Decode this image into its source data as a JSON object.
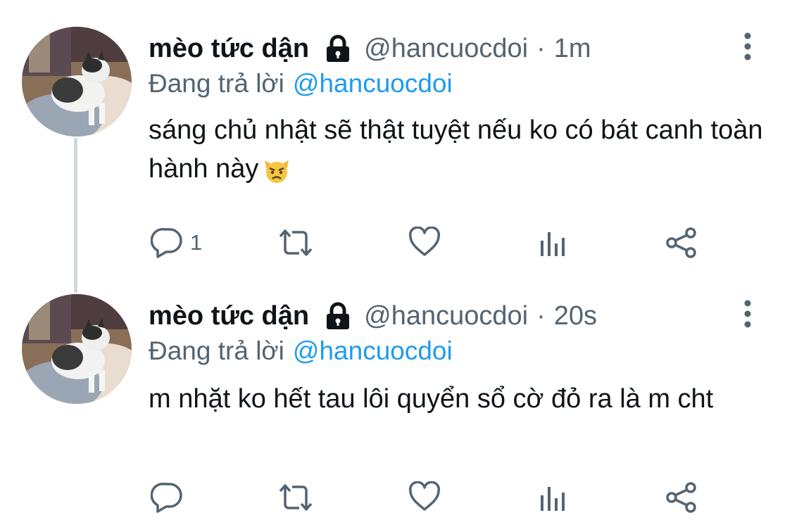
{
  "tweets": [
    {
      "name": "mèo tức dận",
      "handle": "@hancuocdoi",
      "separator": "·",
      "time": "1m",
      "reply_prefix": "Đang trả lời",
      "reply_to": "@hancuocdoi",
      "text": "sáng chủ nhật sẽ thật tuyệt nếu ko có bát canh toàn hành này",
      "emoji": "pouting-cat-emoji",
      "reply_count": "1",
      "retweet_count": "",
      "like_count": ""
    },
    {
      "name": "mèo tức dận",
      "handle": "@hancuocdoi",
      "separator": "·",
      "time": "20s",
      "reply_prefix": "Đang trả lời",
      "reply_to": "@hancuocdoi",
      "text": "m nhặt ko hết tau lôi quyển sổ cờ đỏ ra là m cht",
      "reply_count": "",
      "retweet_count": "",
      "like_count": ""
    }
  ],
  "icons": {
    "lock": "lock-icon",
    "more": "more-vertical-icon",
    "reply": "reply-icon",
    "retweet": "retweet-icon",
    "like": "heart-icon",
    "views": "views-icon",
    "share": "share-icon"
  },
  "colors": {
    "text": "#0f1419",
    "secondary": "#536471",
    "accent": "#1d9bf0",
    "thread_line": "#cfd9de"
  }
}
